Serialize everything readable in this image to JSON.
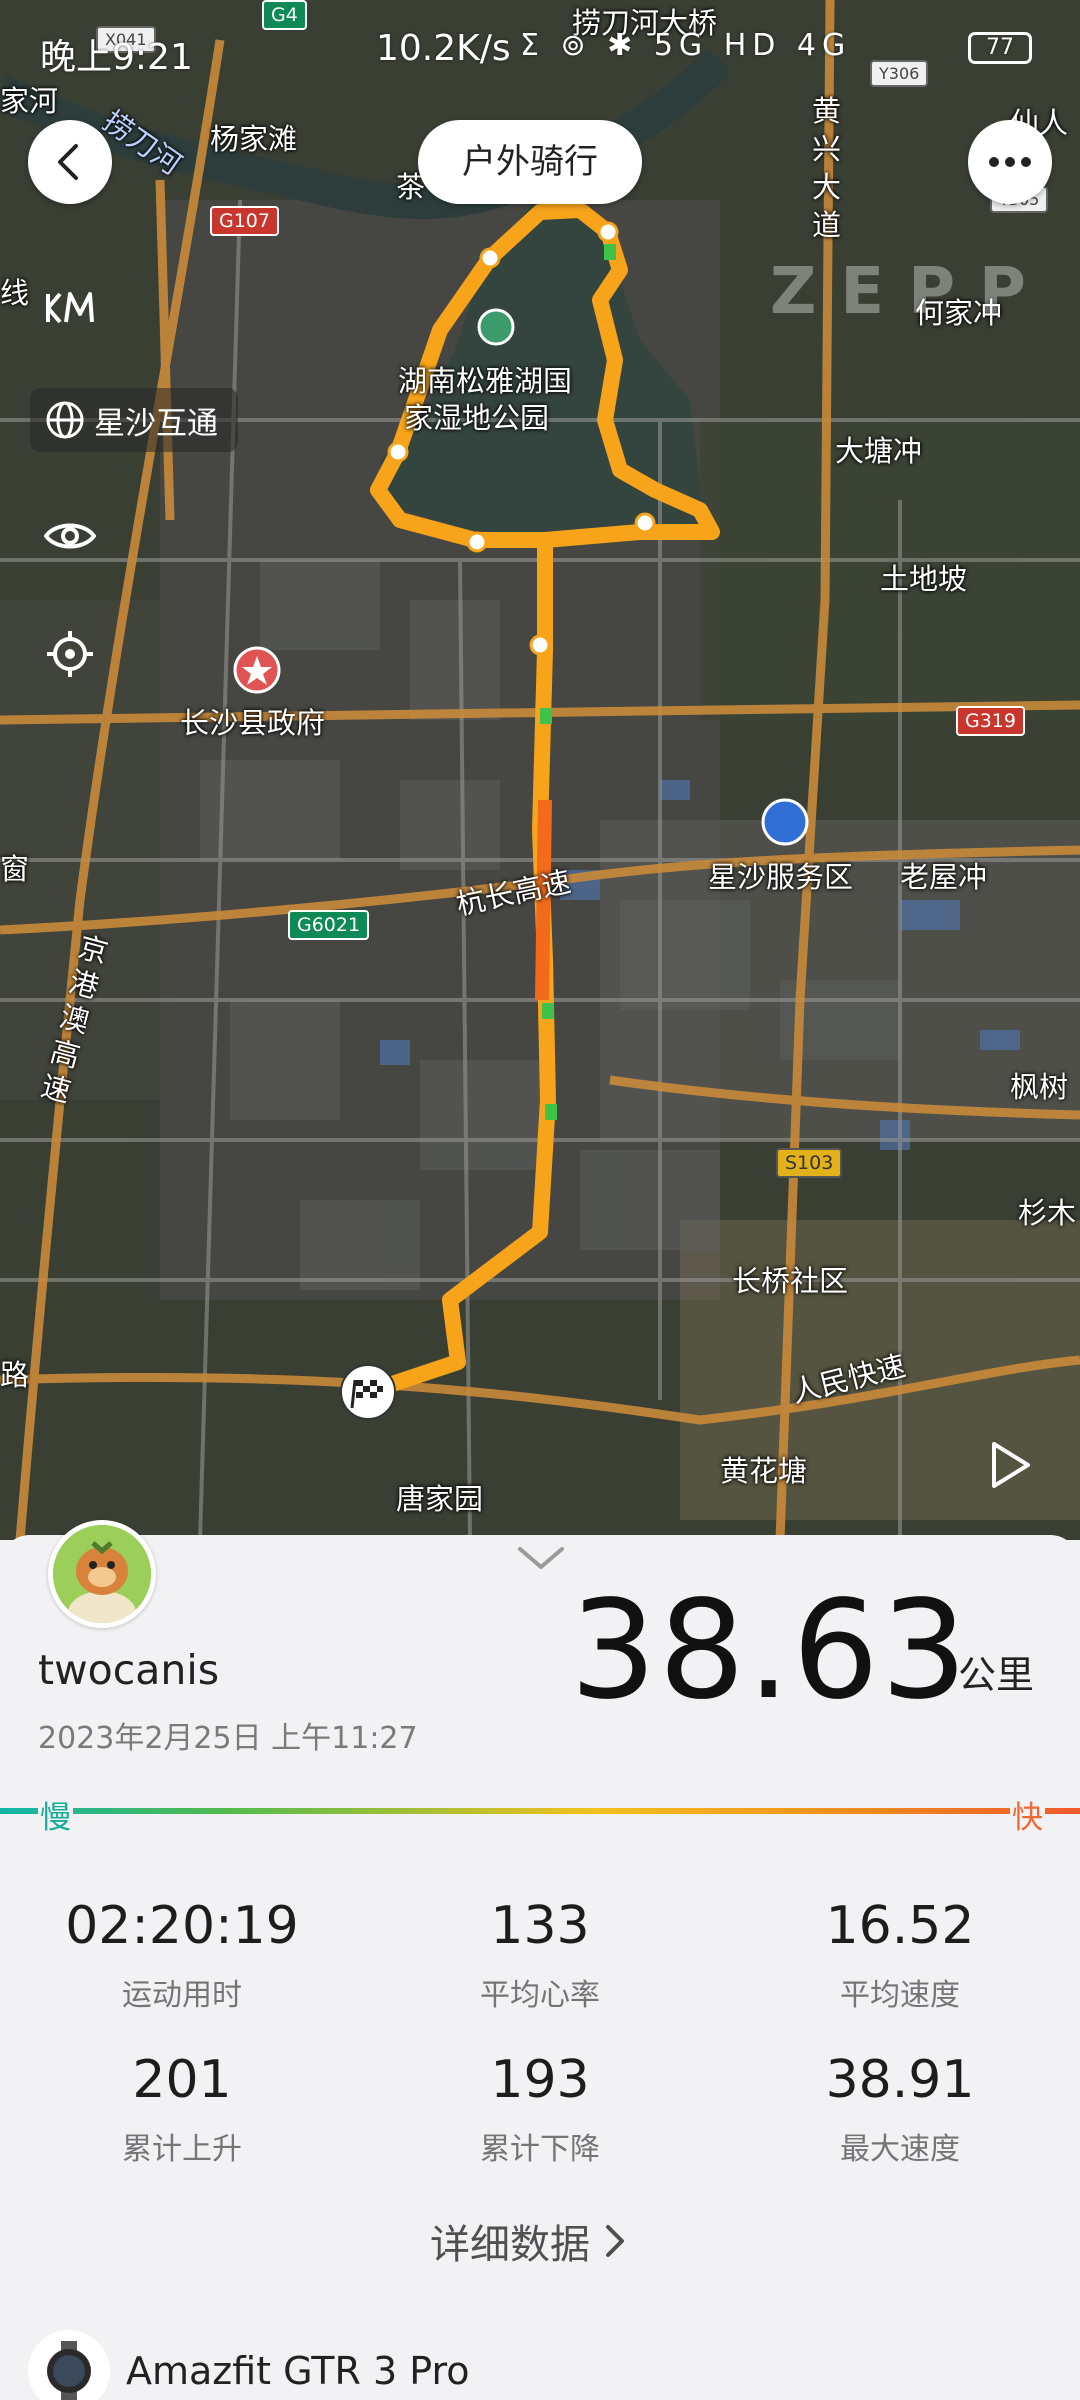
{
  "status_bar": {
    "time": "晚上9:21",
    "net_speed": "10.2K/s",
    "indicators": "Σ ⊚ ✱ 5G HD 4G",
    "battery": "77"
  },
  "header": {
    "title": "户外骑行"
  },
  "map": {
    "layer_label": "星沙互通",
    "watermark": "ZEPP",
    "labels": [
      "捞刀河大桥",
      "捞刀河",
      "杨家滩",
      "家河",
      "茶",
      "湖南松雅湖国",
      "家湿地公园",
      "黄兴大道",
      "何家冲",
      "大塘冲",
      "土地坡",
      "长沙县政府",
      "星沙服务区",
      "老屋冲",
      "杭长高速",
      "京港澳高速",
      "枫树",
      "杉木",
      "长桥社区",
      "人民快速",
      "黄花塘",
      "唐家园",
      "仙人",
      "窗",
      "线",
      "路"
    ],
    "road_tags": [
      "G4",
      "G107",
      "G319",
      "G6021",
      "S103",
      "X041",
      "Y306",
      "Y305"
    ]
  },
  "summary": {
    "username": "twocanis",
    "datetime": "2023年2月25日 上午11:27",
    "distance_value": "38.63",
    "distance_unit": "公里",
    "pace_slow_label": "慢",
    "pace_fast_label": "快"
  },
  "stats": [
    {
      "value": "02:20:19",
      "label": "运动用时"
    },
    {
      "value": "133",
      "label": "平均心率"
    },
    {
      "value": "16.52",
      "label": "平均速度"
    },
    {
      "value": "201",
      "label": "累计上升"
    },
    {
      "value": "193",
      "label": "累计下降"
    },
    {
      "value": "38.91",
      "label": "最大速度"
    }
  ],
  "detail_link": "详细数据",
  "device": {
    "name": "Amazfit GTR 3 Pro"
  }
}
